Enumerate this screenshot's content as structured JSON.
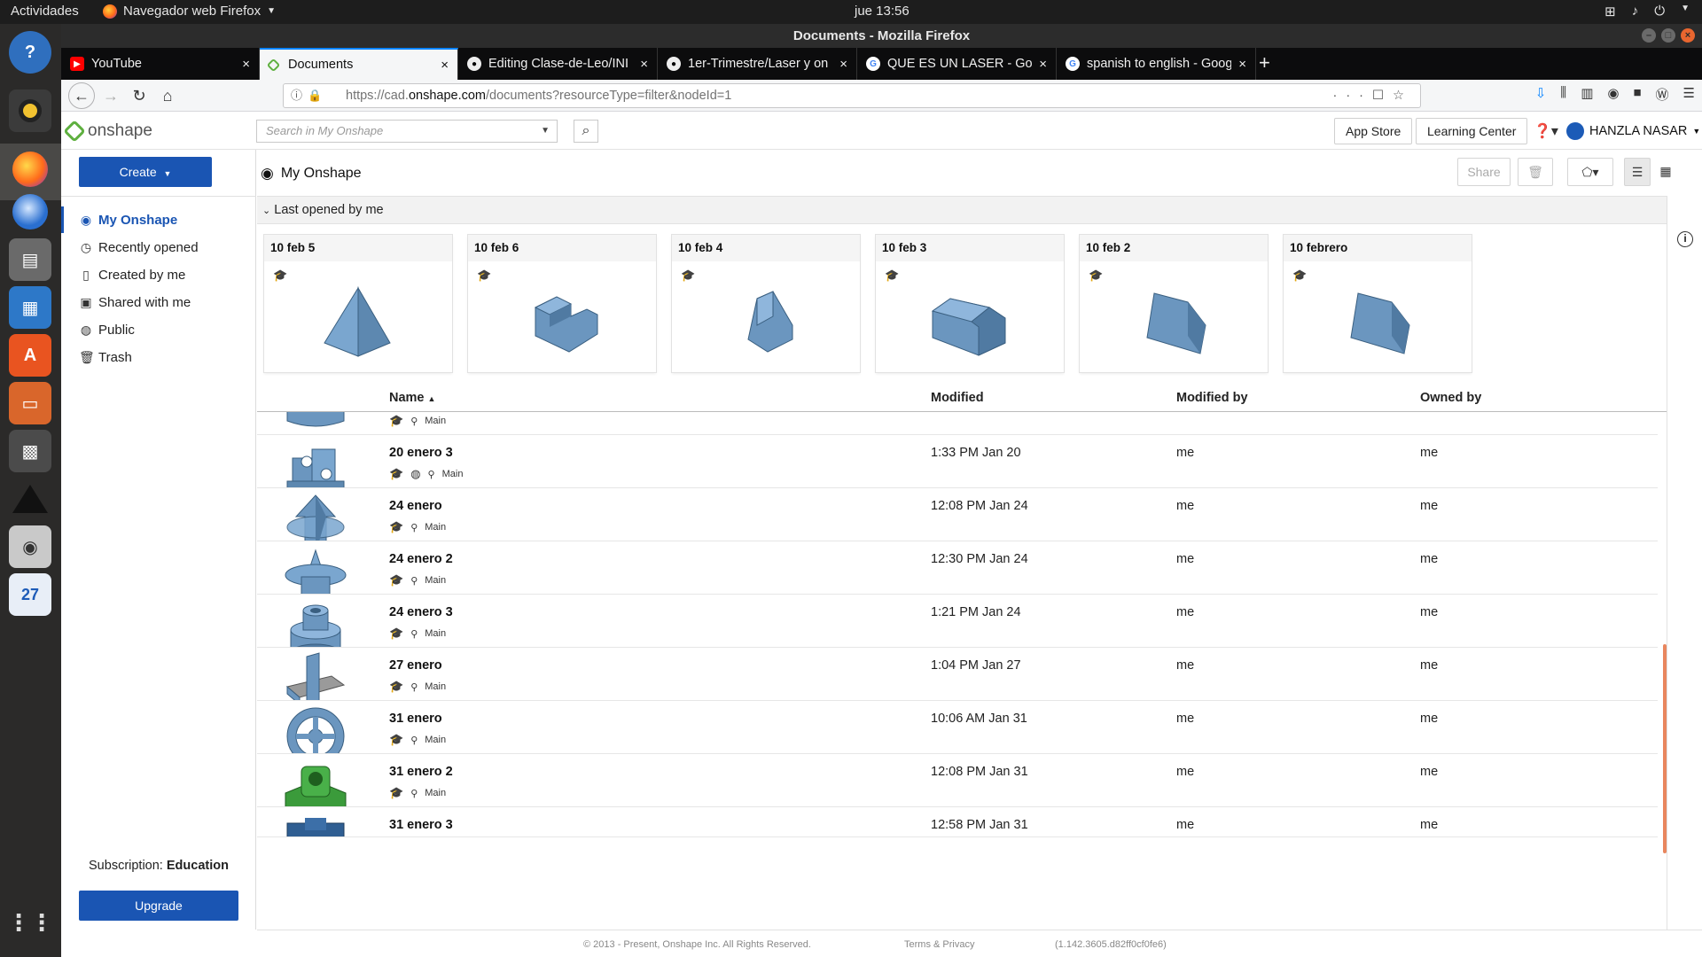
{
  "system": {
    "activities": "Actividades",
    "app_name": "Navegador web Firefox",
    "clock": "jue 13:56"
  },
  "window": {
    "title": "Documents - Mozilla Firefox"
  },
  "tabs": [
    {
      "label": "YouTube",
      "icon": "youtube-icon"
    },
    {
      "label": "Documents",
      "icon": "onshape-icon"
    },
    {
      "label": "Editing Clase-de-Leo/INI",
      "icon": "github-icon"
    },
    {
      "label": "1er-Trimestre/Laser y on",
      "icon": "github-icon"
    },
    {
      "label": "QUE ES UN LASER - Goog",
      "icon": "google-icon"
    },
    {
      "label": "spanish to english - Goog",
      "icon": "google-icon"
    }
  ],
  "url": {
    "prefix": "https://cad.",
    "host": "onshape.com",
    "path": "/documents?resourceType=filter&nodeId=1"
  },
  "header": {
    "logo": "onshape",
    "search_placeholder": "Search in My Onshape",
    "app_store": "App Store",
    "learning_center": "Learning Center",
    "user": "HANZLA NASAR"
  },
  "sidebar": {
    "create": "Create",
    "items": [
      {
        "label": "My Onshape",
        "icon": "user-circle-icon"
      },
      {
        "label": "Recently opened",
        "icon": "clock-icon"
      },
      {
        "label": "Created by me",
        "icon": "document-icon"
      },
      {
        "label": "Shared with me",
        "icon": "shared-document-icon"
      },
      {
        "label": "Public",
        "icon": "globe-icon"
      },
      {
        "label": "Trash",
        "icon": "trash-icon"
      }
    ],
    "subscription_label": "Subscription:",
    "subscription_value": "Education",
    "upgrade": "Upgrade"
  },
  "main": {
    "breadcrumb": "My Onshape",
    "share": "Share",
    "recent_title": "Last opened by me",
    "recent": [
      {
        "title": "10 feb 5",
        "shape": "pyramid"
      },
      {
        "title": "10 feb 6",
        "shape": "step-block"
      },
      {
        "title": "10 feb 4",
        "shape": "wedge-small"
      },
      {
        "title": "10 feb 3",
        "shape": "house-block"
      },
      {
        "title": "10 feb 2",
        "shape": "wedge"
      },
      {
        "title": "10 febrero",
        "shape": "wedge"
      }
    ],
    "columns": {
      "name": "Name",
      "modified": "Modified",
      "modified_by": "Modified by",
      "owned_by": "Owned by"
    },
    "partial_branch": "Main",
    "rows": [
      {
        "name": "20 enero 3",
        "modified": "1:33 PM Jan 20",
        "modified_by": "me",
        "owned_by": "me",
        "branch": "Main",
        "public": true
      },
      {
        "name": "24 enero",
        "modified": "12:08 PM Jan 24",
        "modified_by": "me",
        "owned_by": "me",
        "branch": "Main",
        "public": false
      },
      {
        "name": "24 enero 2",
        "modified": "12:30 PM Jan 24",
        "modified_by": "me",
        "owned_by": "me",
        "branch": "Main",
        "public": false
      },
      {
        "name": "24 enero 3",
        "modified": "1:21 PM Jan 24",
        "modified_by": "me",
        "owned_by": "me",
        "branch": "Main",
        "public": false
      },
      {
        "name": "27 enero",
        "modified": "1:04 PM Jan 27",
        "modified_by": "me",
        "owned_by": "me",
        "branch": "Main",
        "public": false
      },
      {
        "name": "31 enero",
        "modified": "10:06 AM Jan 31",
        "modified_by": "me",
        "owned_by": "me",
        "branch": "Main",
        "public": false
      },
      {
        "name": "31 enero 2",
        "modified": "12:08 PM Jan 31",
        "modified_by": "me",
        "owned_by": "me",
        "branch": "Main",
        "public": false
      },
      {
        "name": "31 enero 3",
        "modified": "12:58 PM Jan 31",
        "modified_by": "me",
        "owned_by": "me",
        "branch": "",
        "public": false
      }
    ]
  },
  "footer": {
    "copyright": "© 2013 - Present, Onshape Inc. All Rights Reserved.",
    "terms": "Terms & Privacy",
    "version": "(1.142.3605.d82ff0cf0fe6)"
  },
  "colors": {
    "accent": "#1a55b3",
    "model_blue": "#6b9ac4",
    "model_green": "#3b9b3b",
    "scroll_thumb": "#e9865e"
  }
}
